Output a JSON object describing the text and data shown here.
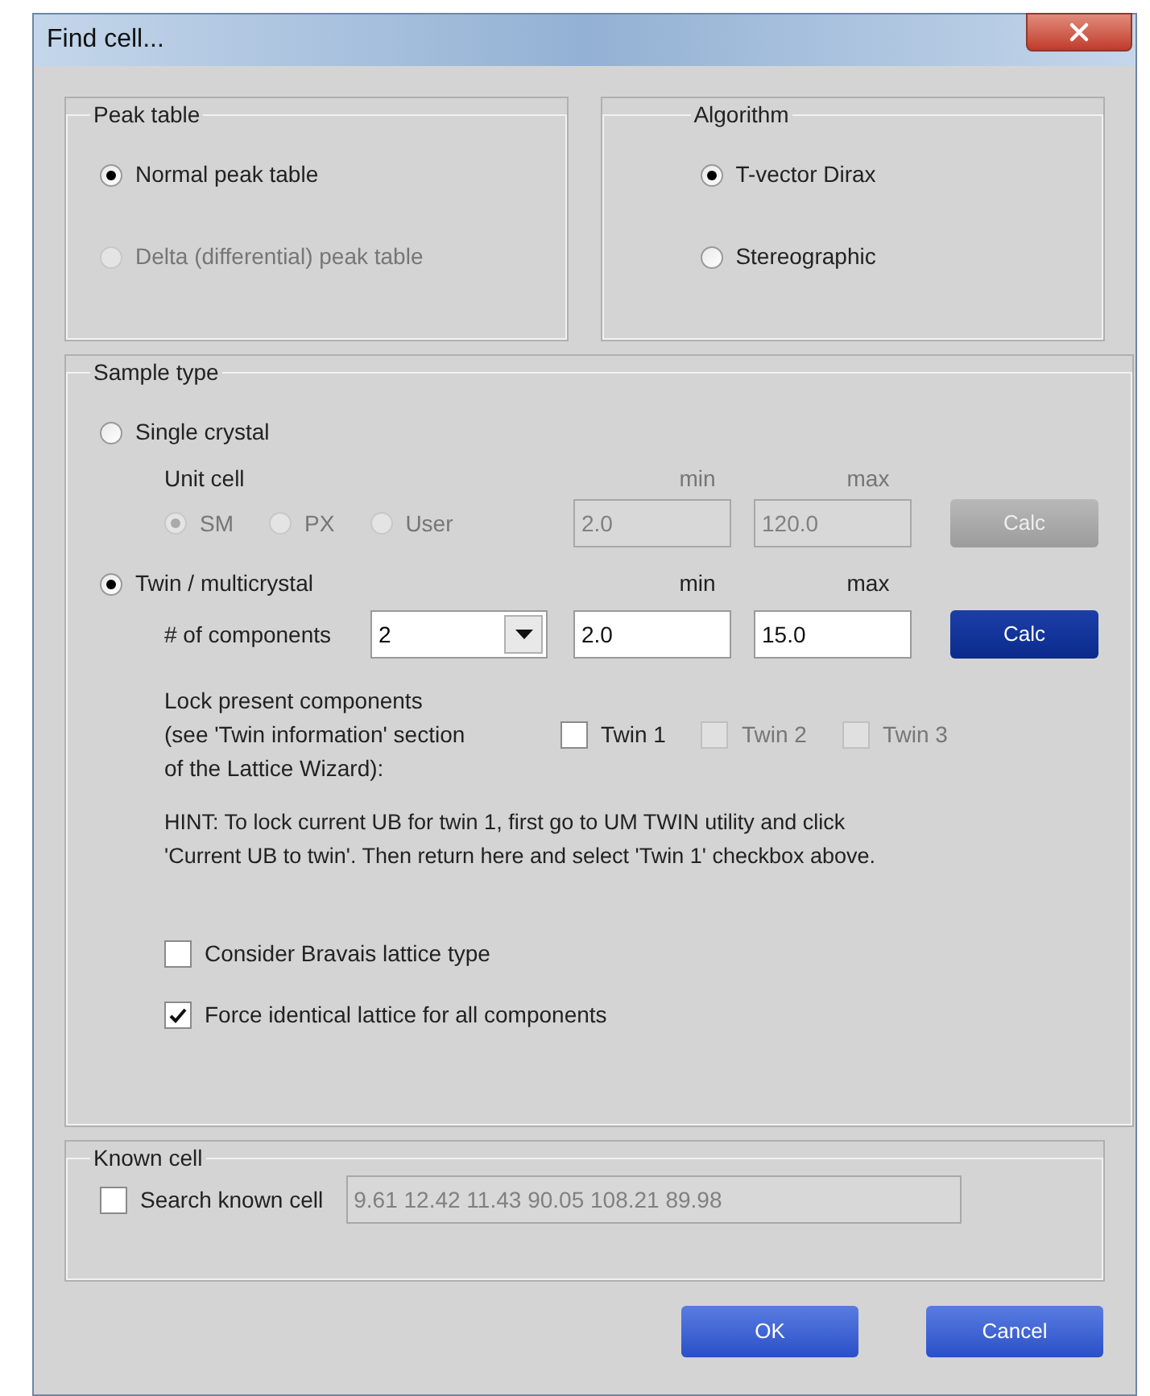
{
  "window": {
    "title": "Find cell..."
  },
  "peak_table": {
    "title": "Peak table",
    "options": [
      {
        "label": "Normal peak table",
        "selected": true,
        "disabled": false
      },
      {
        "label": "Delta (differential) peak table",
        "selected": false,
        "disabled": true
      }
    ]
  },
  "algorithm": {
    "title": "Algorithm",
    "options": [
      {
        "label": "T-vector Dirax",
        "selected": true
      },
      {
        "label": "Stereographic",
        "selected": false
      }
    ]
  },
  "sample_type": {
    "title": "Sample type",
    "single": {
      "label": "Single crystal",
      "selected": false
    },
    "unit_cell": {
      "label": "Unit cell",
      "disabled": true,
      "options": [
        {
          "label": "SM",
          "selected": true
        },
        {
          "label": "PX",
          "selected": false
        },
        {
          "label": "User",
          "selected": false
        }
      ],
      "min_label": "min",
      "max_label": "max",
      "min": "2.0",
      "max": "120.0",
      "calc": "Calc"
    },
    "twin": {
      "label": "Twin / multicrystal",
      "selected": true,
      "disabled": false,
      "components_label": "# of components",
      "components": "2",
      "min_label": "min",
      "max_label": "max",
      "min": "2.0",
      "max": "15.0",
      "calc": "Calc"
    },
    "lock_label": "Lock present components\n(see 'Twin information' section\nof the Lattice Wizard):",
    "twins": [
      {
        "label": "Twin 1",
        "checked": false,
        "disabled": false
      },
      {
        "label": "Twin 2",
        "checked": false,
        "disabled": true
      },
      {
        "label": "Twin 3",
        "checked": false,
        "disabled": true
      }
    ],
    "hint": "HINT: To lock current UB for twin 1, first go to UM TWIN utility and click\n'Current UB to twin'. Then return here and select 'Twin 1' checkbox above.",
    "options": [
      {
        "label": "Consider Bravais lattice type",
        "checked": false
      },
      {
        "label": "Force identical lattice for all components",
        "checked": true
      }
    ]
  },
  "known_cell": {
    "title": "Known cell",
    "checkbox": {
      "label": "Search known cell",
      "checked": false
    },
    "value": "9.61 12.42 11.43 90.05 108.21 89.98",
    "disabled": true
  },
  "buttons": [
    {
      "label": "OK"
    },
    {
      "label": "Cancel"
    }
  ]
}
